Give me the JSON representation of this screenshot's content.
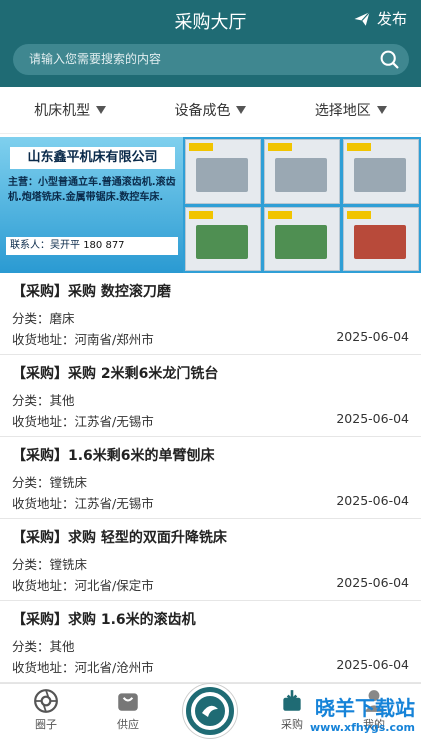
{
  "header": {
    "title": "采购大厅",
    "publish_label": "发布"
  },
  "search": {
    "placeholder": "请输入您需要搜索的内容"
  },
  "filters": [
    "机床机型",
    "设备成色",
    "选择地区"
  ],
  "banner": {
    "company": "山东鑫平机床有限公司",
    "main_business": "主营：小型普通立车.普通滚齿机.滚齿机.炮塔铣床.金属带锯床.数控车床.",
    "contact_label": "联系人：吴开平",
    "contact_phone": "180          877"
  },
  "items": [
    {
      "title": "【采购】采购  数控滚刀磨",
      "category": "分类：磨床",
      "address": "收货地址：河南省/郑州市",
      "date": "2025-06-04"
    },
    {
      "title": "【采购】采购 2米剩6米龙门铣台",
      "category": "分类：其他",
      "address": "收货地址：江苏省/无锡市",
      "date": "2025-06-04"
    },
    {
      "title": "【采购】1.6米剩6米的单臂刨床",
      "category": "分类：镗铣床",
      "address": "收货地址：江苏省/无锡市",
      "date": "2025-06-04"
    },
    {
      "title": "【采购】求购  轻型的双面升降铣床",
      "category": "分类：镗铣床",
      "address": "收货地址：河北省/保定市",
      "date": "2025-06-04"
    },
    {
      "title": "【采购】求购  1.6米的滚齿机",
      "category": "分类：其他",
      "address": "收货地址：河北省/沧州市",
      "date": "2025-06-04"
    }
  ],
  "tabs": {
    "circle": "圈子",
    "supply": "供应",
    "purchase": "采购",
    "mine": "我的"
  },
  "watermark": {
    "text": "晓羊下载站",
    "url": "www.xfhygs.com"
  },
  "colors": {
    "primary": "#1f6b74",
    "search_bg": "#3f8790"
  }
}
